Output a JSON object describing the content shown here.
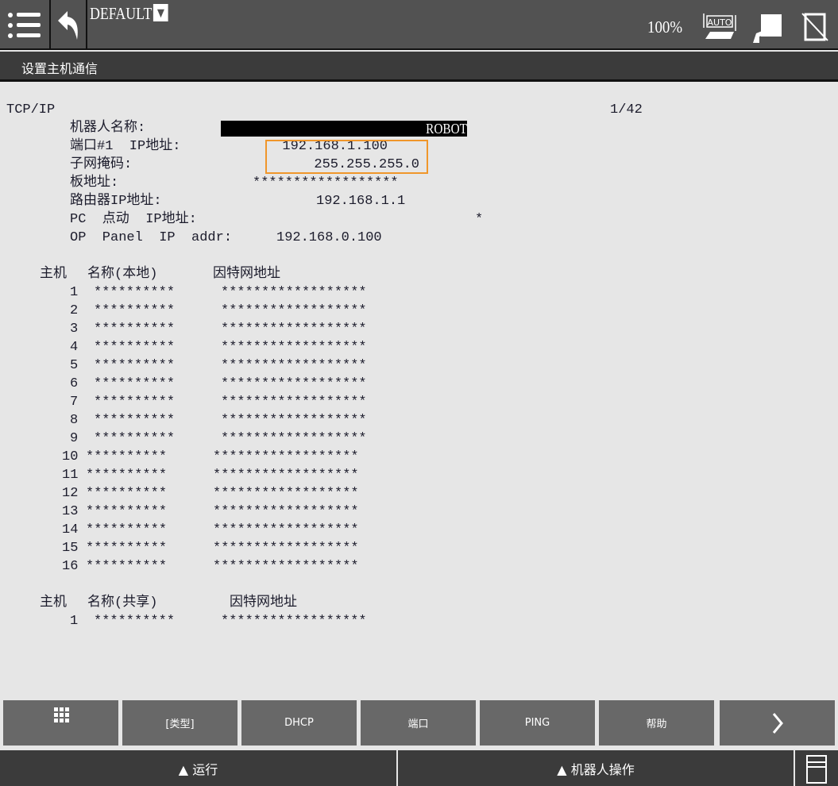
{
  "header": {
    "menu_icon": "menu-list-icon",
    "back_icon": "undo-arrow-icon",
    "program": "DEFAULT",
    "dropdown_glyph": "▼",
    "speed": "100%",
    "icons": [
      "auto-mode-icon",
      "robot-teach-icon",
      "no-tablet-icon"
    ]
  },
  "subheader": {
    "title": "设置主机通信"
  },
  "main": {
    "section": "TCP/IP",
    "page": "1/42",
    "robot_name_label": "机器人名称:",
    "robot_name": "ROBOT",
    "port_ip_label": "端口#1  IP地址:",
    "port_ip": "192.168.1.100",
    "subnet_label": "子网掩码:",
    "subnet": "255.255.255.0",
    "board_label": "板地址:",
    "board": "******************",
    "router_label": "路由器IP地址:",
    "router": "192.168.1.1",
    "pc_label": "PC  点动  IP地址:",
    "pc_value": "*",
    "op_label": "OP  Panel  IP  addr:",
    "op_value": "192.168.0.100",
    "local_header": {
      "host": "主机",
      "name": "名称(本地)",
      "address": "因特网地址"
    },
    "local_hosts": [
      {
        "num": "1",
        "name": "**********",
        "address": "******************"
      },
      {
        "num": "2",
        "name": "**********",
        "address": "******************"
      },
      {
        "num": "3",
        "name": "**********",
        "address": "******************"
      },
      {
        "num": "4",
        "name": "**********",
        "address": "******************"
      },
      {
        "num": "5",
        "name": "**********",
        "address": "******************"
      },
      {
        "num": "6",
        "name": "**********",
        "address": "******************"
      },
      {
        "num": "7",
        "name": "**********",
        "address": "******************"
      },
      {
        "num": "8",
        "name": "**********",
        "address": "******************"
      },
      {
        "num": "9",
        "name": "**********",
        "address": "******************"
      },
      {
        "num": "10",
        "name": "**********",
        "address": "******************"
      },
      {
        "num": "11",
        "name": "**********",
        "address": "******************"
      },
      {
        "num": "12",
        "name": "**********",
        "address": "******************"
      },
      {
        "num": "13",
        "name": "**********",
        "address": "******************"
      },
      {
        "num": "14",
        "name": "**********",
        "address": "******************"
      },
      {
        "num": "15",
        "name": "**********",
        "address": "******************"
      },
      {
        "num": "16",
        "name": "**********",
        "address": "******************"
      }
    ],
    "shared_header": {
      "host": "主机",
      "name": "名称(共享)",
      "address": "因特网地址"
    },
    "shared_hosts": [
      {
        "num": "1",
        "name": "**********",
        "address": "******************"
      }
    ]
  },
  "function_keys": [
    {
      "label": "",
      "icon": "grid-icon"
    },
    {
      "label": "[类型]"
    },
    {
      "label": "DHCP"
    },
    {
      "label": "端口"
    },
    {
      "label": "PING"
    },
    {
      "label": "帮助"
    },
    {
      "label": "",
      "icon": "chevron-right-icon"
    }
  ],
  "bottom": {
    "run": "▲ 运行",
    "robot_op": "▲ 机器人操作"
  },
  "accent": "#f0962a"
}
